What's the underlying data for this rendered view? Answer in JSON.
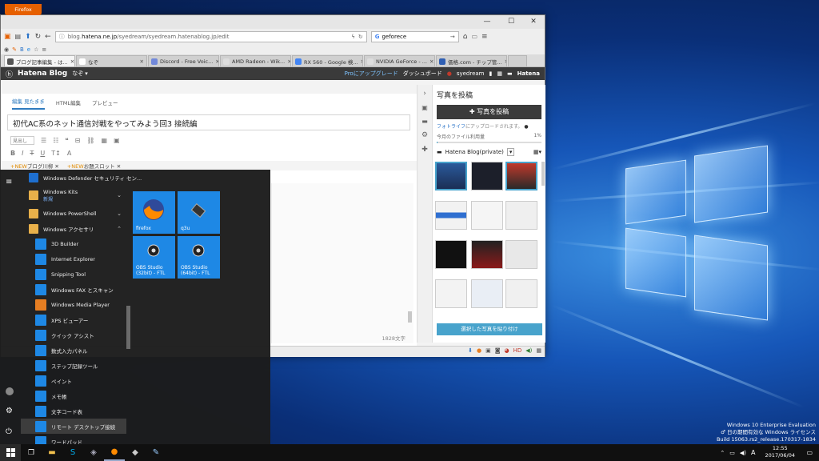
{
  "desktop": {
    "watermark": [
      "Windows 10 Enterprise Evaluation",
      "♂ 日の期間有効な Windows ライセンス",
      "Build 15063.rs2_release.170317-1834"
    ]
  },
  "firefox": {
    "menu_button": "Firefox",
    "url_prefix": "blog.",
    "url_domain": "hatena.ne.jp",
    "url_rest": "/syedream/syedream.hatenablog.jp/edit",
    "search_value": "geforece",
    "tabs": [
      {
        "label": "ブログ記事編集 - は...",
        "color": "#555555"
      },
      {
        "label": "なぞ",
        "color": "#ffffff"
      },
      {
        "label": "Discord - Free Voic...",
        "color": "#7289da"
      },
      {
        "label": "AMD Radeon - Wik...",
        "color": "#dddddd"
      },
      {
        "label": "RX 560 - Google 検...",
        "color": "#4285f4"
      },
      {
        "label": "NVIDIA GeForce - ...",
        "color": "#dddddd"
      },
      {
        "label": "価格.com - チップ管...",
        "color": "#2f5fb3"
      }
    ]
  },
  "hatena": {
    "logo": "Hatena Blog",
    "blog_name": "なぞ",
    "pro_upgrade": "Proにアップグレード",
    "dashboard": "ダッシュボード",
    "user": "syedream",
    "brand": "Hatena",
    "tab_edit": "編集 見たまま",
    "tab_html": "HTML編集",
    "tab_preview": "プレビュー",
    "post_title": "初代AC系のネット通信対戦をやってみよう回3 接続編",
    "heading_select": "見出し",
    "tags": [
      {
        "new": "+NEW",
        "name": "ブログ川柳"
      },
      {
        "new": "+NEW",
        "name": "お題スロット"
      }
    ],
    "char_count": "1828文字",
    "side_title": "写真を投稿",
    "post_photo_button": "写真を投稿",
    "fotolife_link": "フォトライフ",
    "fotolife_rest": "にアップロードされます。",
    "usage_label": "今月のファイル利用量",
    "usage_value": "1%",
    "album": "Hatena Blog(private)",
    "paste_button": "選択した写真を貼り付け"
  },
  "startmenu": {
    "items": [
      {
        "label": "Windows Defender セキュリティ セン...",
        "icon": "shield-icon",
        "color": "#1e6fcf",
        "sub": false,
        "chev": false
      },
      {
        "label": "Windows Kits",
        "icon": "folder-icon",
        "color": "#e8b04a",
        "sub": false,
        "chev": true,
        "badge": "新規"
      },
      {
        "label": "Windows PowerShell",
        "icon": "folder-icon",
        "color": "#e8b04a",
        "sub": false,
        "chev": true
      },
      {
        "label": "Windows アクセサリ",
        "icon": "folder-icon",
        "color": "#e8b04a",
        "sub": false,
        "chev": true,
        "open": true
      },
      {
        "label": "3D Builder",
        "icon": "3d-builder-icon",
        "color": "#1e88e5",
        "sub": true
      },
      {
        "label": "Internet Explorer",
        "icon": "internet-explorer-icon",
        "color": "#1e88e5",
        "sub": true
      },
      {
        "label": "Snipping Tool",
        "icon": "scissors-icon",
        "color": "#1e88e5",
        "sub": true
      },
      {
        "label": "Windows FAX とスキャン",
        "icon": "fax-icon",
        "color": "#1e88e5",
        "sub": true
      },
      {
        "label": "Windows Media Player",
        "icon": "media-player-icon",
        "color": "#e67e22",
        "sub": true
      },
      {
        "label": "XPS ビューアー",
        "icon": "xps-viewer-icon",
        "color": "#1e88e5",
        "sub": true
      },
      {
        "label": "クイック アシスト",
        "icon": "quick-assist-icon",
        "color": "#1e88e5",
        "sub": true
      },
      {
        "label": "数式入力パネル",
        "icon": "math-input-icon",
        "color": "#1e88e5",
        "sub": true
      },
      {
        "label": "ステップ記録ツール",
        "icon": "steps-recorder-icon",
        "color": "#1e88e5",
        "sub": true
      },
      {
        "label": "ペイント",
        "icon": "paint-icon",
        "color": "#1e88e5",
        "sub": true
      },
      {
        "label": "メモ帳",
        "icon": "notepad-icon",
        "color": "#1e88e5",
        "sub": true
      },
      {
        "label": "文字コード表",
        "icon": "char-map-icon",
        "color": "#1e88e5",
        "sub": true
      },
      {
        "label": "リモート デスクトップ接続",
        "icon": "remote-desktop-icon",
        "color": "#1e88e5",
        "sub": true,
        "highlight": true
      },
      {
        "label": "ワードパッド",
        "icon": "wordpad-icon",
        "color": "#1e88e5",
        "sub": true
      }
    ],
    "tiles": [
      {
        "label": "firefox"
      },
      {
        "label": "q3u"
      },
      {
        "label": "OBS Studio\n(32bit) - FTL"
      },
      {
        "label": "OBS Studio\n(64bit) - FTL"
      }
    ]
  },
  "taskbar": {
    "ime": "A",
    "time": "12:55",
    "date": "2017/06/04"
  }
}
